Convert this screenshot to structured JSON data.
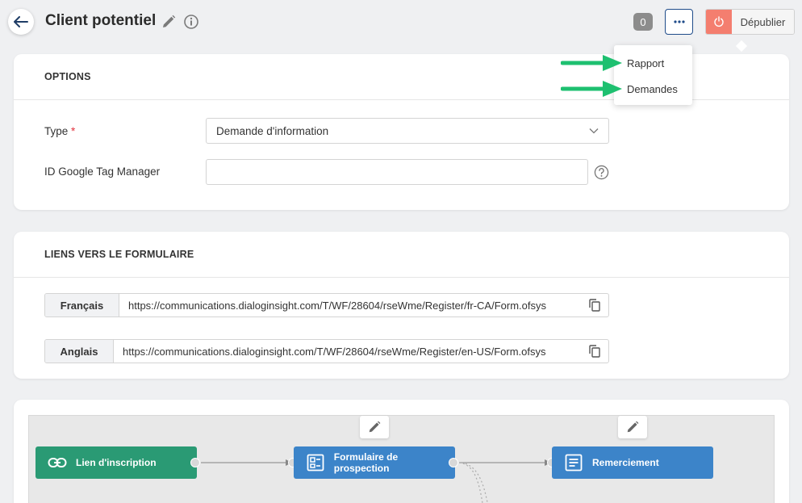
{
  "header": {
    "title": "Client potentiel",
    "count": "0",
    "unpublish_label": "Dépublier"
  },
  "menu": {
    "items": [
      "Rapport",
      "Demandes"
    ]
  },
  "options": {
    "title": "OPTIONS",
    "type_label": "Type",
    "required_mark": "*",
    "type_value": "Demande d'information",
    "gtm_label": "ID Google Tag Manager",
    "gtm_value": ""
  },
  "links": {
    "title": "LIENS VERS LE FORMULAIRE",
    "rows": [
      {
        "lang": "Français",
        "url": "https://communications.dialoginsight.com/T/WF/28604/rseWme/Register/fr-CA/Form.ofsys"
      },
      {
        "lang": "Anglais",
        "url": "https://communications.dialoginsight.com/T/WF/28604/rseWme/Register/en-US/Form.ofsys"
      }
    ]
  },
  "flow": {
    "nodes": [
      {
        "label": "Lien d'inscription",
        "icon": "link-icon",
        "color": "#2a9a74"
      },
      {
        "label": "Formulaire de prospection",
        "icon": "form-icon",
        "color": "#3c84c9"
      },
      {
        "label": "Remerciement",
        "icon": "document-icon",
        "color": "#3c84c9"
      }
    ]
  },
  "colors": {
    "accent": "#1f4c8a",
    "unpublish": "#f47e6f",
    "arrow": "#1ec070",
    "required": "#e2323e"
  }
}
